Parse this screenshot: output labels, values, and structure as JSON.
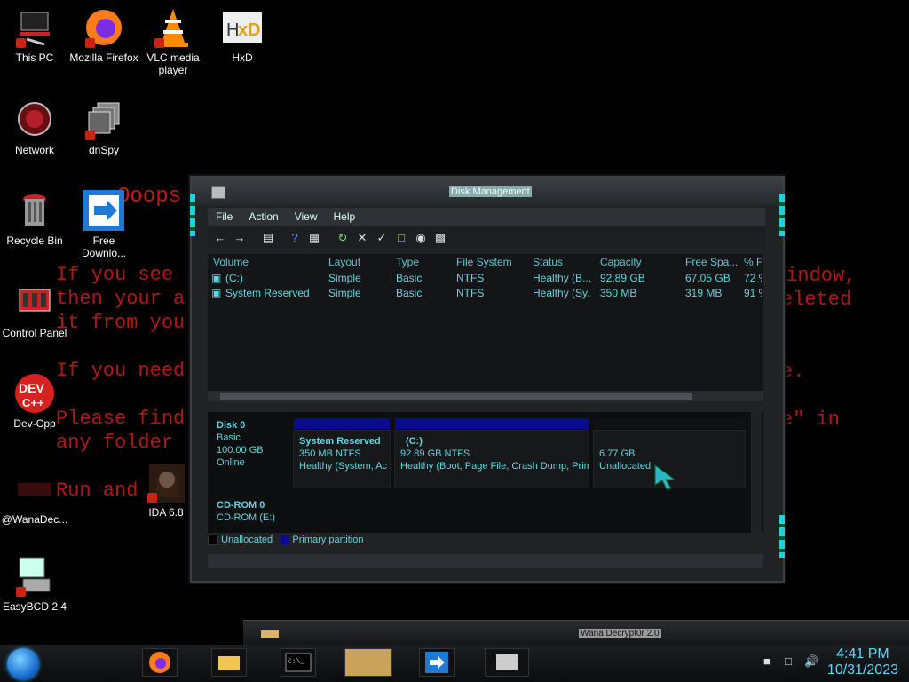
{
  "desktop": {
    "icons": [
      {
        "label": "This PC"
      },
      {
        "label": "Mozilla Firefox"
      },
      {
        "label": "VLC media player"
      },
      {
        "label": "HxD"
      },
      {
        "label": "Network"
      },
      {
        "label": "dnSpy"
      },
      {
        "label": "Recycle Bin"
      },
      {
        "label": "Free Downlo..."
      },
      {
        "label": "Control Panel"
      },
      {
        "label": "Dev-Cpp"
      },
      {
        "label": "@WanaDec..."
      },
      {
        "label": "IDA 6.8"
      },
      {
        "label": "EasyBCD 2.4"
      }
    ],
    "ransom_lines": {
      "oops": "Ooops",
      "l1": "If you see",
      "l2": "then your a",
      "l3": "it from you",
      "l4": "If you need",
      "l5": "Please find",
      "l6": "any folder",
      "l7": "Run and",
      "r1": "window,",
      "r2": "eleted",
      "r4": "e.",
      "r5": "e\" in"
    }
  },
  "window": {
    "title": "Disk Management",
    "menu": [
      "File",
      "Action",
      "View",
      "Help"
    ],
    "columns": [
      "Volume",
      "Layout",
      "Type",
      "File System",
      "Status",
      "Capacity",
      "Free Spa...",
      "% F"
    ],
    "volumes": [
      [
        "(C:)",
        "Simple",
        "Basic",
        "NTFS",
        "Healthy (B...",
        "92.89 GB",
        "67.05 GB",
        "72 %"
      ],
      [
        "System Reserved",
        "Simple",
        "Basic",
        "NTFS",
        "Healthy (Sy...",
        "350 MB",
        "319 MB",
        "91 %"
      ]
    ],
    "disks": {
      "disk0": {
        "name": "Disk 0",
        "type": "Basic",
        "size": "100.00 GB",
        "state": "Online"
      },
      "cdrom0": {
        "name": "CD-ROM 0",
        "sub": "CD-ROM (E:)"
      }
    },
    "partitions": [
      {
        "name": "System Reserved",
        "size": "350 MB NTFS",
        "status": "Healthy (System, Ac"
      },
      {
        "name": "(C:)",
        "size": "92.89 GB NTFS",
        "status": "Healthy (Boot, Page File, Crash Dump, Prim"
      },
      {
        "name": "",
        "size": "6.77 GB",
        "status": "Unallocated"
      }
    ],
    "legend": {
      "unallocated": "Unallocated",
      "primary": "Primary partition"
    }
  },
  "taskbar": {
    "secondary_title": "Wana Decrypt0r 2.0",
    "time": "4:41 PM",
    "date": "10/31/2023"
  },
  "colors": {
    "accent": "#19d3df",
    "text_cyan": "#5fd7e0",
    "ransom_red": "#b01818",
    "primary_partition": "#0a0a8c"
  }
}
